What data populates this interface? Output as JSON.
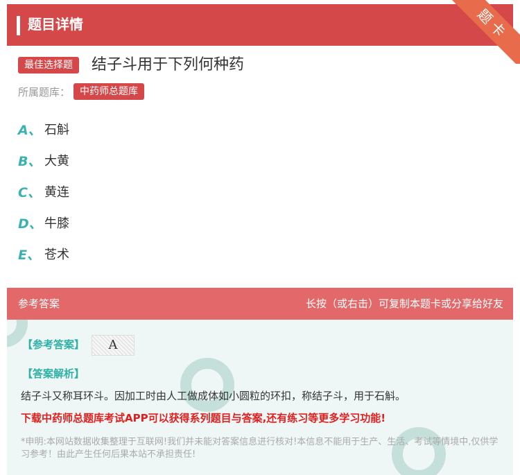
{
  "header": {
    "title": "题目详情",
    "ribbon": "题卡"
  },
  "question": {
    "type_tag": "最佳选择题",
    "text": "结子斗用于下列何种药",
    "bank_label": "所属题库：",
    "bank_name": "中药师总题库"
  },
  "options": [
    {
      "letter": "A、",
      "text": "石斛"
    },
    {
      "letter": "B、",
      "text": "大黄"
    },
    {
      "letter": "C、",
      "text": "黄连"
    },
    {
      "letter": "D、",
      "text": "牛膝"
    },
    {
      "letter": "E、",
      "text": "苍术"
    }
  ],
  "answer_section": {
    "title": "参考答案",
    "hint": "长按（或右击）可复制本题卡或分享给好友",
    "answer_label": "【参考答案】",
    "answer_value": "A",
    "explanation_label": "【答案解析】",
    "explanation": "结子斗又称耳环斗。因加工时由人工做成体如小圆粒的环扣，称结子斗，用于石斛。",
    "promo": "下载中药师总题库考试APP可以获得系列题目与答案,还有练习等更多学习功能!",
    "disclaimer": "*申明:本网站数据收集整理于互联网!我们并未能对答案信息进行核对!本信息不能用于生产、生活、考试等情境中,仅供学习参考！由此产生任何后果本站不承担责任!"
  },
  "colors": {
    "primary": "#d5484a",
    "accent": "#3ab3b0",
    "promo": "#e01f1f"
  }
}
